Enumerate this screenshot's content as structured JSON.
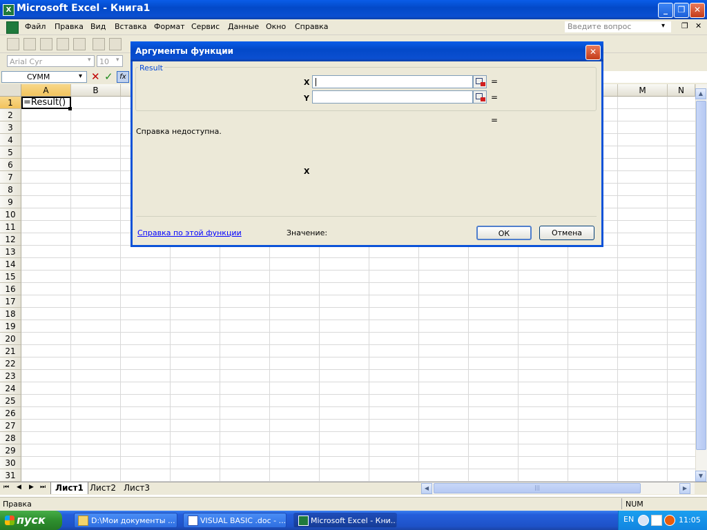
{
  "window": {
    "title": "Microsoft Excel - Книга1",
    "icon": "excel-icon",
    "icon_glyph": "X",
    "minimize_glyph": "_",
    "restore_glyph": "❐",
    "close_glyph": "✕"
  },
  "menu": {
    "items": [
      "Файл",
      "Правка",
      "Вид",
      "Вставка",
      "Формат",
      "Сервис",
      "Данные",
      "Окно",
      "Справка"
    ],
    "help_placeholder": "Введите вопрос",
    "help_arrow": "▾",
    "doc_restore_glyph": "❐",
    "doc_close_glyph": "✕"
  },
  "toolbar": {
    "font_name": "Arial Cyr",
    "font_size": "10",
    "combo_arrow": "▾"
  },
  "formula_bar": {
    "name_box": "СУММ",
    "name_arrow": "▾",
    "cancel_glyph": "✕",
    "enter_glyph": "✓",
    "fx_glyph": "fx"
  },
  "grid": {
    "columns": [
      "A",
      "B",
      "M",
      "N"
    ],
    "rows": [
      "1",
      "2",
      "3",
      "4",
      "5",
      "6",
      "7",
      "8",
      "9",
      "10",
      "11",
      "12",
      "13",
      "14",
      "15",
      "16",
      "17",
      "18",
      "19",
      "20",
      "21",
      "22",
      "23",
      "24",
      "25",
      "26",
      "27",
      "28",
      "29",
      "30",
      "31"
    ],
    "active_cell_value": "=Result()"
  },
  "sheets": {
    "tabs": [
      "Лист1",
      "Лист2",
      "Лист3"
    ],
    "nav": [
      "⏮",
      "◀",
      "▶",
      "⏭"
    ],
    "scroll_grip": "|||",
    "left_arrow": "◀",
    "right_arrow": "▶",
    "up_arrow": "▲",
    "down_arrow": "▼"
  },
  "status": {
    "mode": "Правка",
    "num": "NUM"
  },
  "taskbar": {
    "start": "пуск",
    "items": [
      "D:\\Мои документы ...",
      "VISUAL BASIC .doc - ...",
      "Microsoft Excel - Кни..."
    ],
    "lang": "EN",
    "clock": "11:05"
  },
  "dialog": {
    "title": "Аргументы функции",
    "close_glyph": "✕",
    "group_label": "Result",
    "args": [
      {
        "label": "X",
        "value": ""
      },
      {
        "label": "Y",
        "value": ""
      }
    ],
    "equals": "=",
    "help_text": "Справка недоступна.",
    "arg_description": "X",
    "help_link": "Справка по этой функции",
    "value_label": "Значение:",
    "ok_label": "ОК",
    "cancel_label": "Отмена"
  },
  "colors": {
    "titlebar": "#0a52d8",
    "dialog_bg": "#ece9d8",
    "link": "#0000ff",
    "group_label": "#0046d5"
  }
}
